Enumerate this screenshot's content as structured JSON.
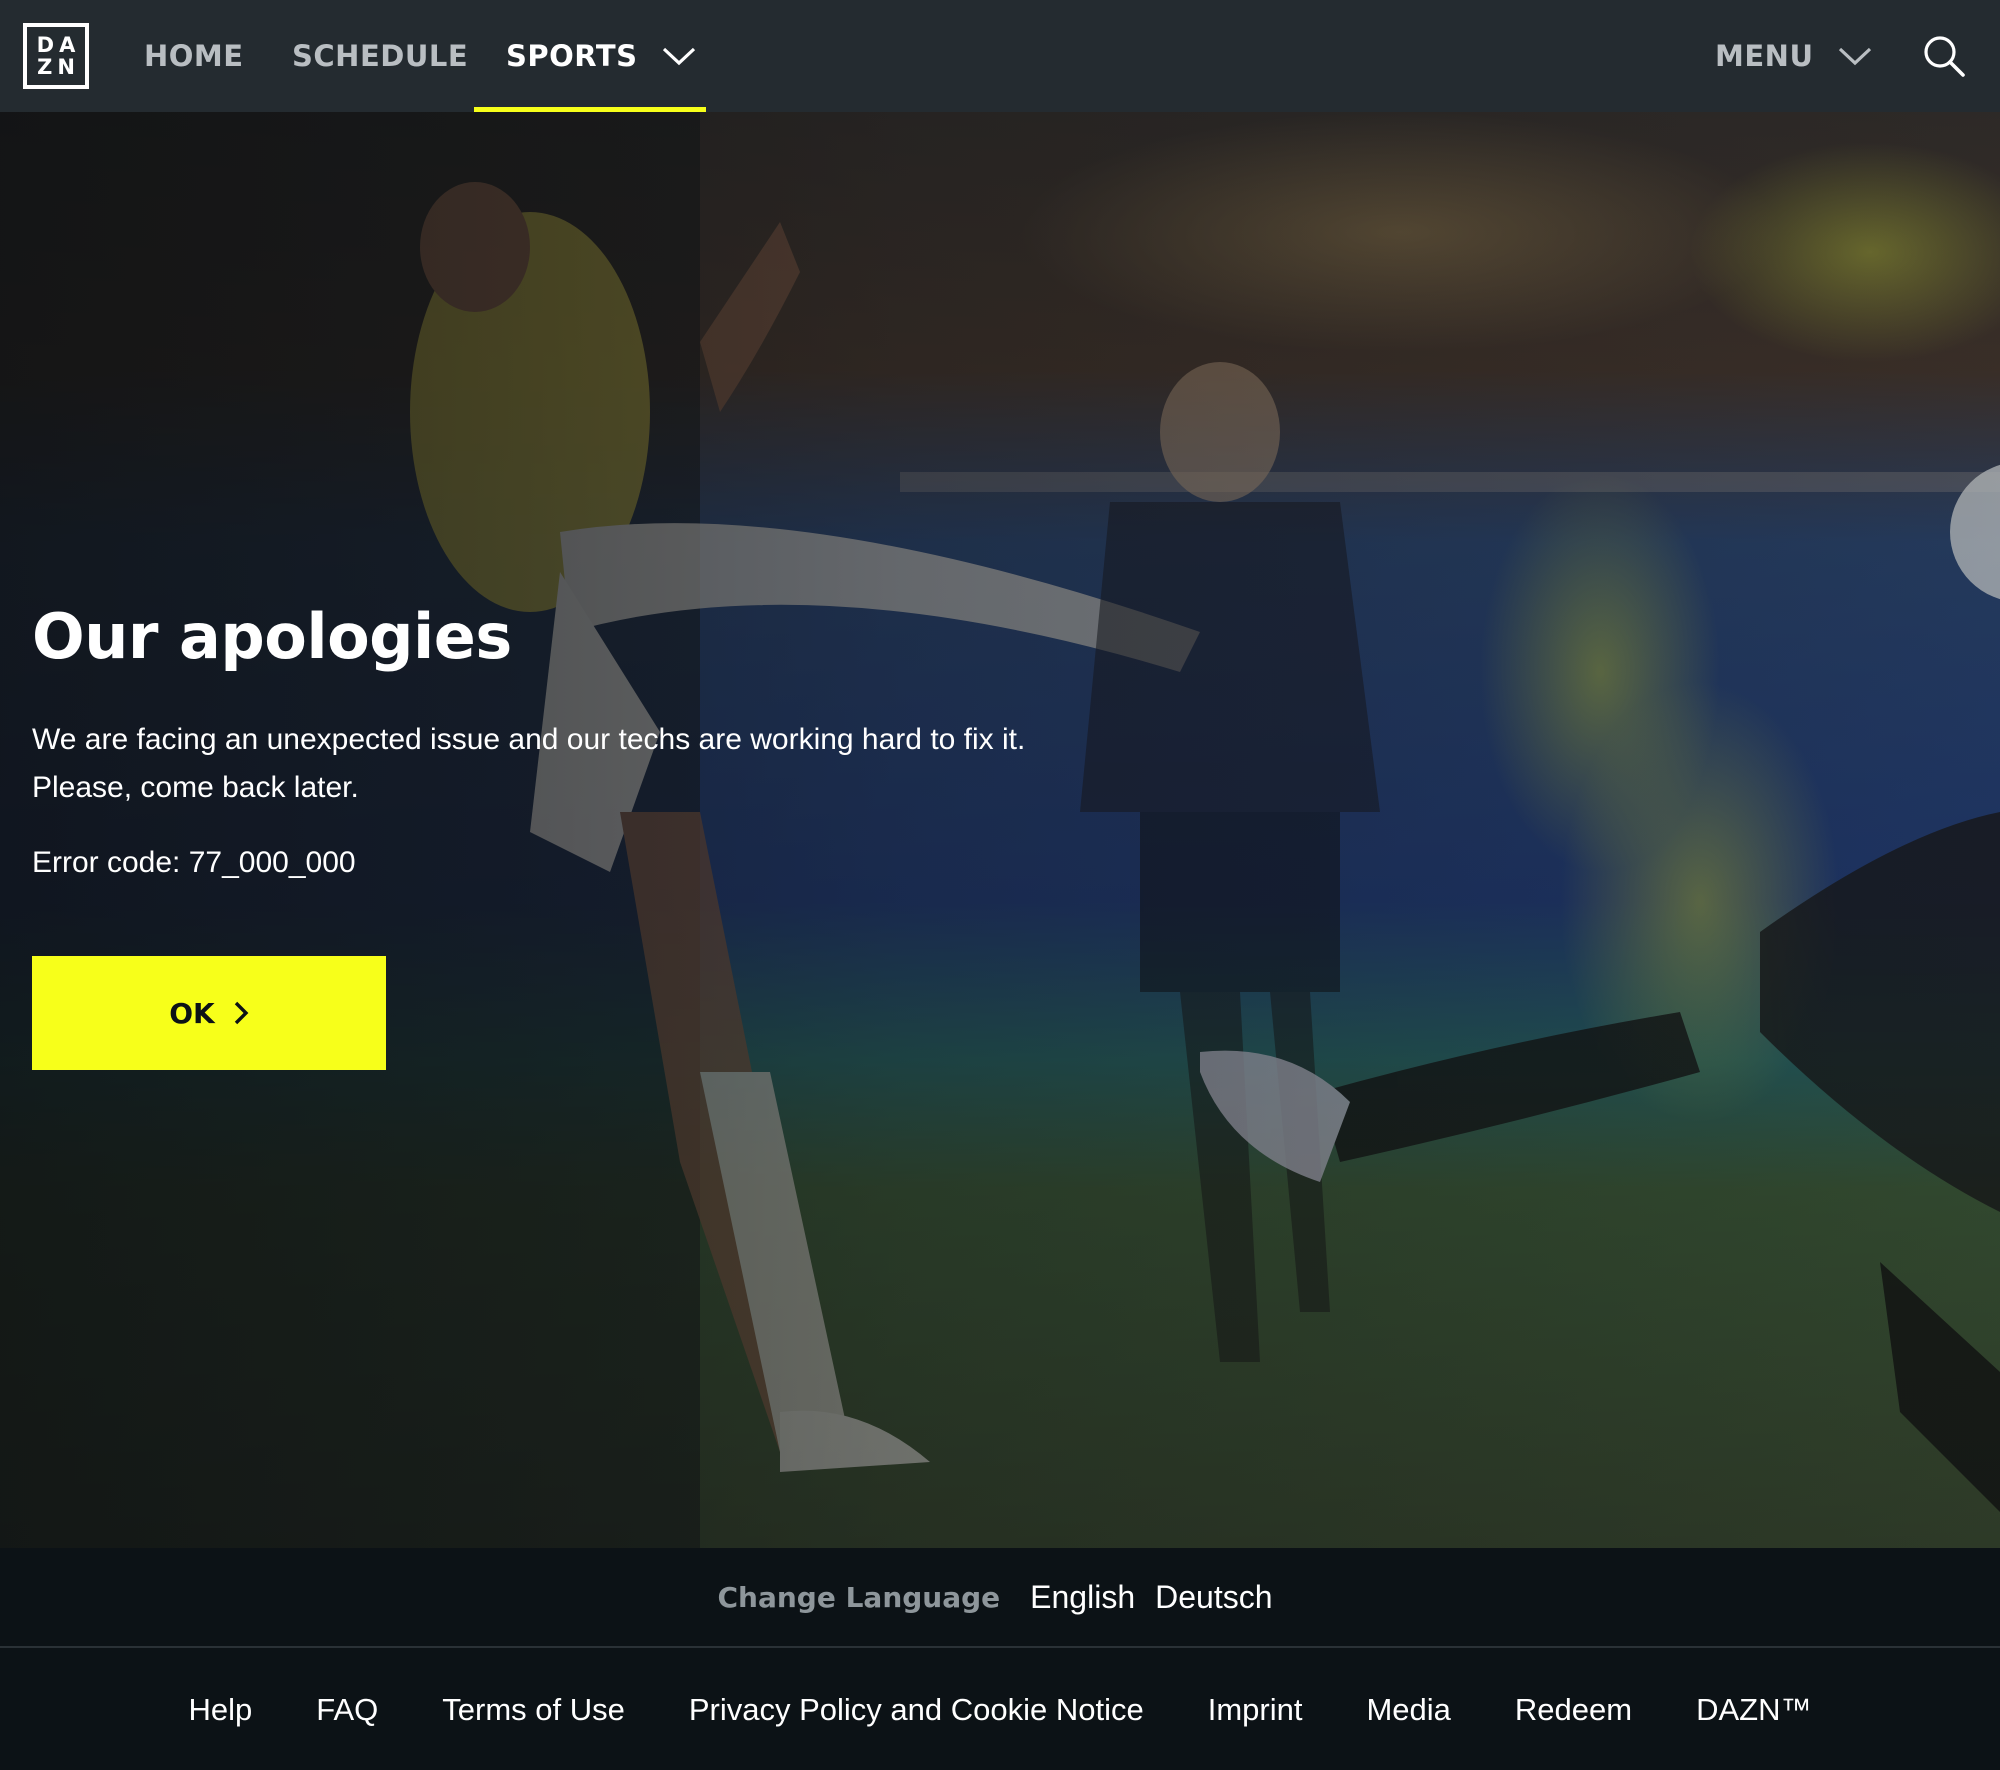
{
  "brand": {
    "logo_top": "DA",
    "logo_bottom": "ZN",
    "accent_color": "#f7ff1a"
  },
  "nav": {
    "home": "HOME",
    "schedule": "SCHEDULE",
    "sports": "SPORTS",
    "menu": "MENU",
    "active_tab": "SPORTS",
    "icons": {
      "sports_dropdown": "chevron-down-icon",
      "menu_dropdown": "chevron-down-icon",
      "search": "search-icon"
    }
  },
  "error": {
    "title": "Our apologies",
    "message_line1": "We are facing an unexpected issue and our techs are working hard to fix it.",
    "message_line2": "Please, come back later.",
    "code": "Error code: 77_000_000",
    "ok_label": "OK",
    "ok_icon": "chevron-right-icon"
  },
  "language": {
    "label": "Change Language",
    "options": [
      "English",
      "Deutsch"
    ]
  },
  "footer": {
    "links": [
      "Help",
      "FAQ",
      "Terms of Use",
      "Privacy Policy and Cookie Notice",
      "Imprint",
      "Media",
      "Redeem",
      "DAZN™"
    ]
  }
}
